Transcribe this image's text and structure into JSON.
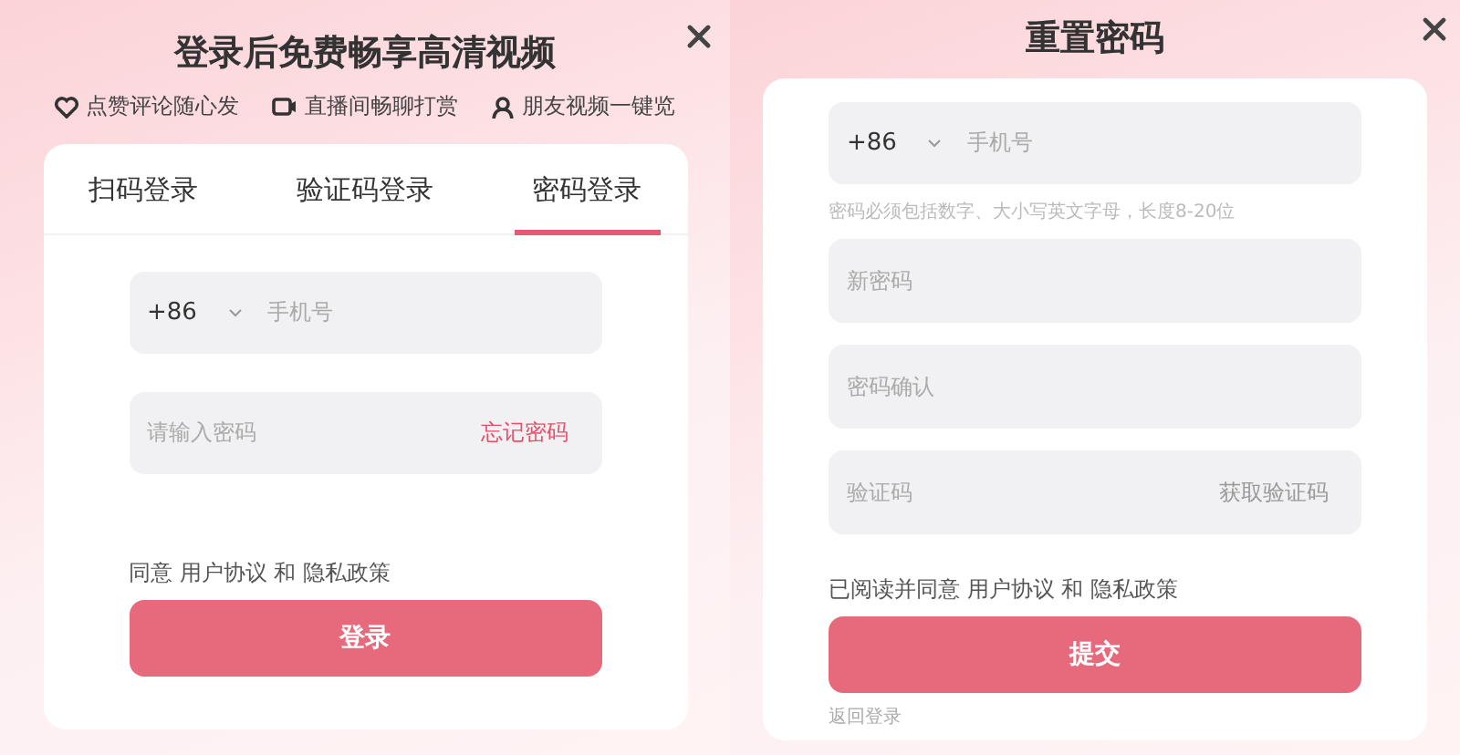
{
  "login_dialog": {
    "title": "登录后免费畅享高清视频",
    "features": [
      {
        "kind": "heart",
        "label": "点赞评论随心发"
      },
      {
        "kind": "camera",
        "label": "直播间畅聊打赏"
      },
      {
        "kind": "friends",
        "label": "朋友视频一键览"
      }
    ],
    "tabs": [
      {
        "label": "扫码登录",
        "selected": false
      },
      {
        "label": "验证码登录",
        "selected": false
      },
      {
        "label": "密码登录",
        "selected": true
      }
    ],
    "phone_field": {
      "country_code": "+86",
      "placeholder": "手机号"
    },
    "password_field": {
      "placeholder": "请输入密码",
      "action": "忘记密码"
    },
    "agreement": {
      "prefix": "同意",
      "terms": "用户协议",
      "joiner": "和",
      "privacy": "隐私政策"
    },
    "submit": {
      "label": "登录",
      "disabled": true
    }
  },
  "reset_dialog": {
    "title": "重置密码",
    "phone_field": {
      "country_code": "+86",
      "placeholder": "手机号"
    },
    "hint": "密码必须包括数字、大小写英文字母，长度8-20位",
    "fields": [
      {
        "placeholder": "新密码"
      },
      {
        "placeholder": "密码确认"
      },
      {
        "placeholder": "验证码",
        "action": "获取验证码"
      }
    ],
    "agreement": {
      "prefix": "已阅读并同意",
      "terms": "用户协议",
      "joiner": "和",
      "privacy": "隐私政策"
    },
    "submit": {
      "label": "提交",
      "disabled": true
    },
    "back_link": "返回登录"
  }
}
